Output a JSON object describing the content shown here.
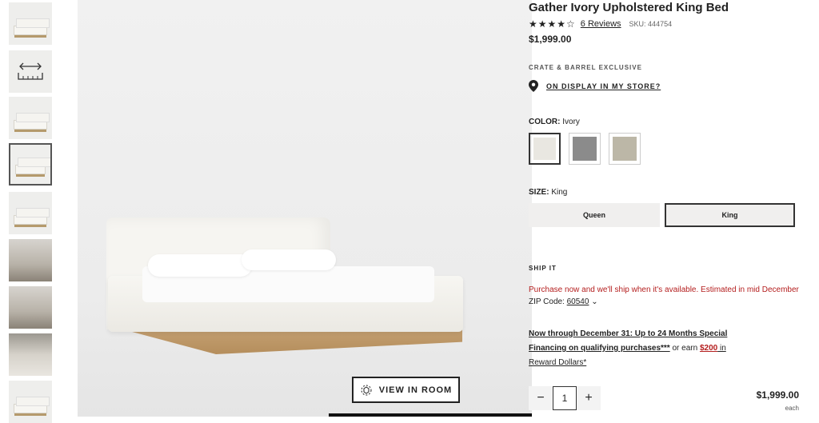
{
  "product": {
    "title": "Gather Ivory Upholstered King Bed",
    "stars": "★★★★☆",
    "reviews": "6 Reviews",
    "sku": "SKU: 444754",
    "price": "$1,999.00",
    "rating": 4
  },
  "exclusive": "CRATE & BARREL EXCLUSIVE",
  "display_link": "ON DISPLAY IN MY STORE?",
  "color": {
    "label": "COLOR:",
    "value": "Ivory",
    "swatches": [
      "#e9e7e1",
      "#8b8b8b",
      "#bcb7a7"
    ],
    "selected": 0
  },
  "size": {
    "label": "SIZE:",
    "value": "King",
    "options": [
      "Queen",
      "King"
    ],
    "selected": 1
  },
  "shipping": {
    "heading": "SHIP IT",
    "message": "Purchase now and we'll ship when it's available. Estimated in mid December",
    "zip_label": "ZIP Code:",
    "zip": "60540"
  },
  "financing": {
    "line1": "Now through December 31: Up to 24 Months Special",
    "line2": "Financing on qualifying purchases***",
    "mid": " or earn ",
    "amount": "$200",
    "after": " in",
    "line3": "Reward Dollars*"
  },
  "quantity": {
    "minus": "−",
    "value": "1",
    "plus": "+"
  },
  "total": {
    "price": "$1,999.00",
    "unit": "each"
  },
  "view_in_room": "VIEW IN ROOM"
}
